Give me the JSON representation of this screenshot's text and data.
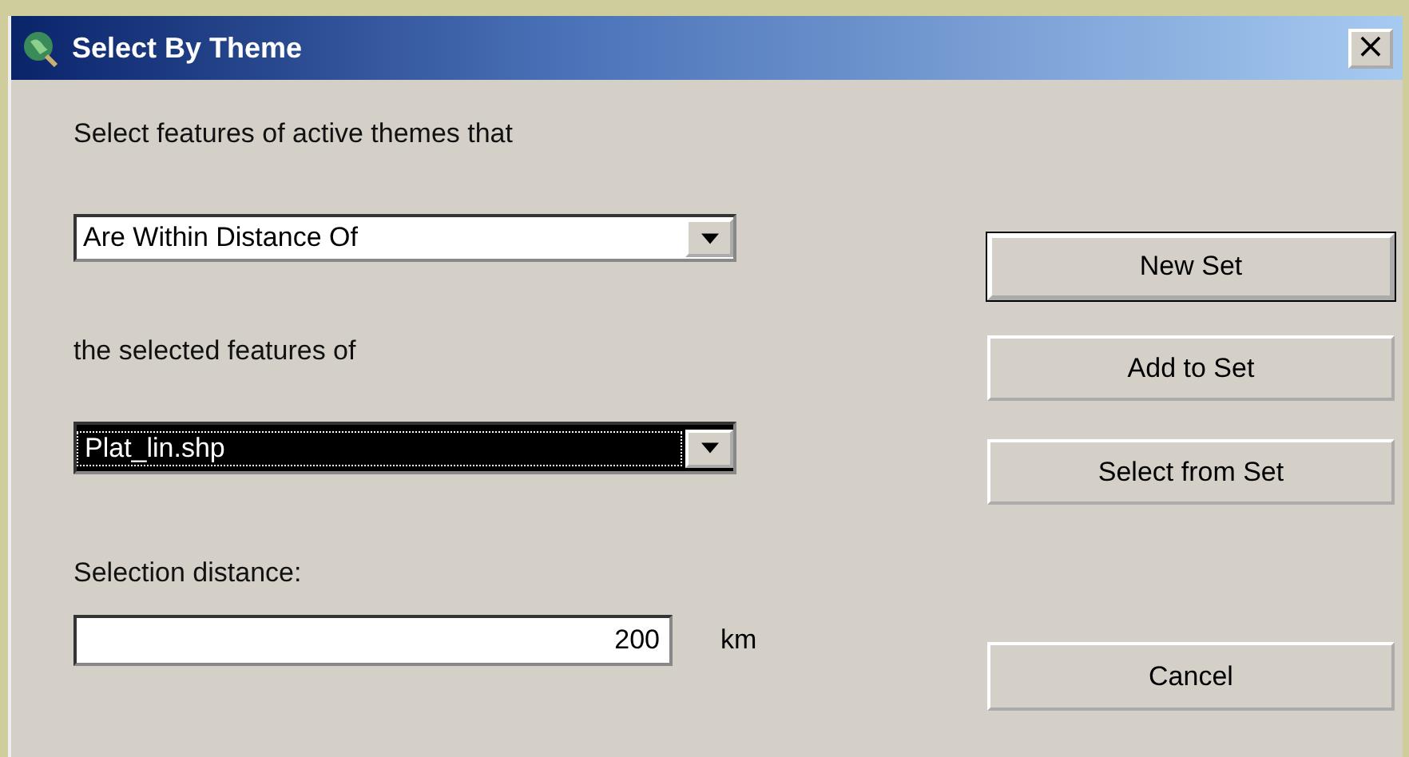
{
  "window": {
    "title": "Select By Theme",
    "close": "×"
  },
  "prompt": "Select features of active themes that",
  "relation": {
    "value": "Are Within Distance Of",
    "focused": false
  },
  "theme_label": "the selected features of",
  "theme": {
    "value": "Plat_lin.shp",
    "focused": true
  },
  "distance_label": "Selection distance:",
  "distance": {
    "value": "200",
    "unit": "km"
  },
  "buttons": [
    {
      "label": "New Set",
      "default": true
    },
    {
      "label": "Add to Set",
      "default": false
    },
    {
      "label": "Select from Set",
      "default": false
    },
    {
      "label": "Cancel",
      "default": false
    }
  ]
}
